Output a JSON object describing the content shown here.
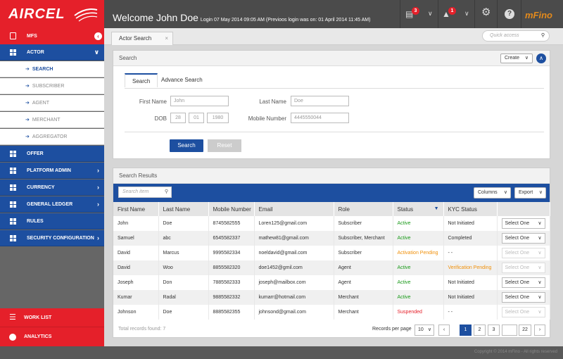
{
  "brand": {
    "logo": "AIRCEL",
    "product": "mFino"
  },
  "header": {
    "welcome": "Welcome John Doe",
    "login_info": "Login 07 May 2014 09:05 AM (Previoos login was on: 01 April 2014 11:45 AM)",
    "messages_count": "3",
    "notifications_count": "1",
    "help_icon": "?"
  },
  "sidebar": {
    "mfs": "MFS",
    "actor": "ACTOR",
    "actor_subitems": [
      "SEARCH",
      "SUBSCRIBER",
      "AGENT",
      "MERCHANT",
      "AGGREGATOR"
    ],
    "items": [
      "OFFER",
      "PLATFORM ADMIN",
      "CURRENCY",
      "GENERAL LEDGER",
      "RULES",
      "SECURITY CONFIGURATION"
    ],
    "work_list": "WORK LIST",
    "analytics": "ANALYTICS"
  },
  "tabs": {
    "actor_search": "Actor Search",
    "close": "×"
  },
  "quick_access": {
    "placeholder": "Quick access"
  },
  "search_panel": {
    "title": "Search",
    "create_label": "Create",
    "tabs": [
      "Search",
      "Advance Search"
    ],
    "first_name_label": "First Name",
    "first_name_value": "John",
    "last_name_label": "Last Name",
    "last_name_value": "Doe",
    "dob_label": "DOB",
    "dob_day": "28",
    "dob_month": "01",
    "dob_year": "1980",
    "mobile_label": "Mobile Number",
    "mobile_value": "4445550044",
    "search_btn": "Search",
    "reset_btn": "Reset"
  },
  "results": {
    "title": "Search Results",
    "search_placeholder": "Search item",
    "columns_btn": "Columns",
    "export_btn": "Export",
    "headers": [
      "First Name",
      "Last Name",
      "Mobile Number",
      "Email",
      "Role",
      "Status",
      "KYC Status",
      ""
    ],
    "rows": [
      {
        "first": "John",
        "last": "Doe",
        "mobile": "8745582555",
        "email": "Loren125@gmail.com",
        "role": "Subscriber",
        "status": "Active",
        "kyc": "Not Initiated",
        "action": "Select One"
      },
      {
        "first": "Samuel",
        "last": "abc",
        "mobile": "6545582337",
        "email": "mathew81@gmail.com",
        "role": "Subscriber, Merchant",
        "status": "Active",
        "kyc": "Completed",
        "action": "Select One"
      },
      {
        "first": "David",
        "last": "Marcus",
        "mobile": "9995582334",
        "email": "noeldavid@gmail.com",
        "role": "Subscriber",
        "status": "Activation Pending",
        "kyc": "- -",
        "action": "Select One"
      },
      {
        "first": "David",
        "last": "Woo",
        "mobile": "8855582320",
        "email": "doe1452@gmil.com",
        "role": "Agent",
        "status": "Active",
        "kyc": "Verification Pending",
        "action": "Select One"
      },
      {
        "first": "Joseph",
        "last": "Don",
        "mobile": "7885582333",
        "email": "joseph@mailbox.com",
        "role": "Agent",
        "status": "Active",
        "kyc": "Not Initiated",
        "action": "Select One"
      },
      {
        "first": "Kumar",
        "last": "Radal",
        "mobile": "9885582332",
        "email": "kumarr@hotmail.com",
        "role": "Merchant",
        "status": "Active",
        "kyc": "Not Initiated",
        "action": "Select One"
      },
      {
        "first": "Johnson",
        "last": "Doe",
        "mobile": "8885582355",
        "email": "johnsond@gmail.com",
        "role": "Merchant",
        "status": "Suspended",
        "kyc": "- -",
        "action": "Select One"
      }
    ],
    "total": "Total records found: 7",
    "records_per_page_label": "Records per page",
    "records_per_page": "10",
    "pages": [
      "1",
      "2",
      "3"
    ],
    "last_page": "22"
  },
  "footer": {
    "copyright": "Copyright © 2014 mFino - All rights reserved"
  },
  "colors": {
    "brand_red": "#e5202a",
    "nav_blue": "#1d4fa0",
    "active_green": "#1a9a1a",
    "pending_orange": "#f0900a",
    "suspended_red": "#e5202a"
  }
}
